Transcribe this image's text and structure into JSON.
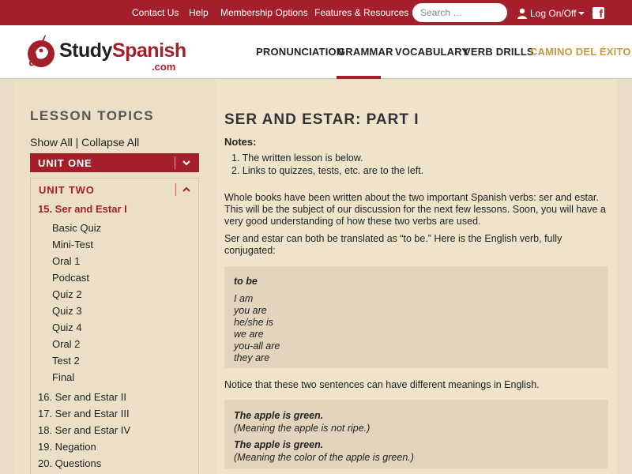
{
  "topbar": {
    "links": [
      "Contact Us",
      "Help",
      "Membership Options",
      "Features & Resources"
    ],
    "search_placeholder": "Search …",
    "login_label": "Log On/Off",
    "facebook_letter": "f"
  },
  "header": {
    "logo_study": "Study",
    "logo_spanish": "Spanish",
    "logo_com": ".com",
    "nav": [
      "PRONUNCIATION",
      "GRAMMAR",
      "VOCABULARY",
      "VERB DRILLS",
      "CAMINO DEL ÉXITO"
    ]
  },
  "sidebar": {
    "title": "LESSON TOPICS",
    "show_all": "Show All",
    "divider": "|",
    "collapse_all": "Collapse All",
    "unit_one": "UNIT ONE",
    "unit_two": "UNIT TWO",
    "current_lesson": "15. Ser and Estar I",
    "sub_items": [
      "Basic Quiz",
      "Mini-Test",
      "Oral 1",
      "Podcast",
      "Quiz 2",
      "Quiz 3",
      "Quiz 4",
      "Oral 2",
      "Test 2",
      "Final"
    ],
    "lessons": [
      "16. Ser and Estar II",
      "17. Ser and Estar III",
      "18. Ser and Estar IV",
      "19. Negation",
      "20. Questions"
    ]
  },
  "main": {
    "title": "SER AND ESTAR: PART I",
    "notes_label": "Notes:",
    "notes": [
      "The written lesson is below.",
      "Links to quizzes, tests, etc. are to the left."
    ],
    "para1": "Whole books have been written about the two important Spanish verbs: ser and estar. This will be the subject of our discussion for the next few lessons. Soon, you will have a very good understanding of how these two verbs are used.",
    "para2": "Ser and estar can both be translated as “to be.” Here is the English verb, fully conjugated:",
    "conj_heading": "to be",
    "conjugation": [
      "I am",
      "you are",
      "he/she is",
      "we are",
      "you-all are",
      "they are"
    ],
    "para3": "Notice that these two sentences can have different meanings in English.",
    "examples": [
      {
        "sentence": "The apple is green.",
        "meaning": "(Meaning the apple is not ripe.)"
      },
      {
        "sentence": "The apple is green.",
        "meaning": "(Meaning the color of the apple is green.)"
      }
    ]
  },
  "colors": {
    "brand_red": "#a3202b",
    "gold": "#c69a3a",
    "page_bg": "#e9dcc6"
  }
}
